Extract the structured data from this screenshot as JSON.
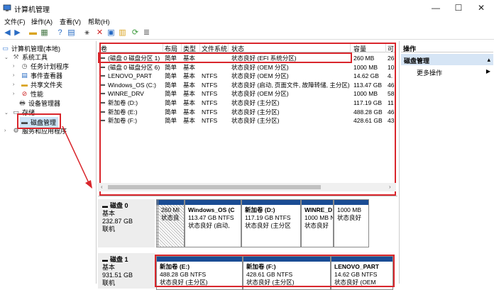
{
  "window": {
    "title": "计算机管理",
    "minimize": "—",
    "maximize": "☐",
    "close": "✕"
  },
  "menu": [
    "文件(F)",
    "操作(A)",
    "查看(V)",
    "帮助(H)"
  ],
  "tree": {
    "root": "计算机管理(本地)",
    "system_tools": "系统工具",
    "task_scheduler": "任务计划程序",
    "event_viewer": "事件查看器",
    "shared_folders": "共享文件夹",
    "performance": "性能",
    "device_manager": "设备管理器",
    "storage": "存储",
    "disk_management": "磁盘管理",
    "services": "服务和应用程序"
  },
  "columns": [
    "卷",
    "布局",
    "类型",
    "文件系统",
    "状态",
    "容量",
    "可"
  ],
  "volumes": [
    {
      "name": "(磁盘 0 磁盘分区 1)",
      "layout": "简单",
      "type": "基本",
      "fs": "",
      "status": "状态良好 (EFI 系统分区)",
      "capacity": "260 MB",
      "free": "26"
    },
    {
      "name": "(磁盘 0 磁盘分区 6)",
      "layout": "简单",
      "type": "基本",
      "fs": "",
      "status": "状态良好 (OEM 分区)",
      "capacity": "1000 MB",
      "free": "10"
    },
    {
      "name": "LENOVO_PART",
      "layout": "简单",
      "type": "基本",
      "fs": "NTFS",
      "status": "状态良好 (OEM 分区)",
      "capacity": "14.62 GB",
      "free": "4."
    },
    {
      "name": "Windows_OS (C:)",
      "layout": "简单",
      "type": "基本",
      "fs": "NTFS",
      "status": "状态良好 (启动, 页面文件, 故障转储, 主分区)",
      "capacity": "113.47 GB",
      "free": "46"
    },
    {
      "name": "WINRE_DRV",
      "layout": "简单",
      "type": "基本",
      "fs": "NTFS",
      "status": "状态良好 (OEM 分区)",
      "capacity": "1000 MB",
      "free": "58"
    },
    {
      "name": "新加卷 (D:)",
      "layout": "简单",
      "type": "基本",
      "fs": "NTFS",
      "status": "状态良好 (主分区)",
      "capacity": "117.19 GB",
      "free": "11"
    },
    {
      "name": "新加卷 (E:)",
      "layout": "简单",
      "type": "基本",
      "fs": "NTFS",
      "status": "状态良好 (主分区)",
      "capacity": "488.28 GB",
      "free": "46"
    },
    {
      "name": "新加卷 (F:)",
      "layout": "简单",
      "type": "基本",
      "fs": "NTFS",
      "status": "状态良好 (主分区)",
      "capacity": "428.61 GB",
      "free": "43"
    }
  ],
  "disk0": {
    "name": "磁盘 0",
    "kind": "基本",
    "size": "232.87 GB",
    "state": "联机",
    "parts": [
      {
        "l1": "",
        "l2": "",
        "l3": ""
      },
      {
        "l1": "",
        "l2": "260 MI",
        "l3": "状态良"
      },
      {
        "l1": "Windows_OS (C",
        "l2": "113.47 GB NTFS",
        "l3": "状态良好 (启动,"
      },
      {
        "l1": "新加卷 (D:)",
        "l2": "117.19 GB NTFS",
        "l3": "状态良好 (主分区"
      },
      {
        "l1": "WINRE_D",
        "l2": "1000 MB N",
        "l3": "状态良好"
      },
      {
        "l1": "",
        "l2": "1000 MB",
        "l3": "状态良好"
      }
    ]
  },
  "disk1": {
    "name": "磁盘 1",
    "kind": "基本",
    "size": "931.51 GB",
    "state": "联机",
    "parts": [
      {
        "l1": "新加卷 (E:)",
        "l2": "488.28 GB NTFS",
        "l3": "状态良好 (主分区)"
      },
      {
        "l1": "新加卷 (F:)",
        "l2": "428.61 GB NTFS",
        "l3": "状态良好 (主分区)"
      },
      {
        "l1": "LENOVO_PART",
        "l2": "14.62 GB NTFS",
        "l3": "状态良好 (OEM"
      }
    ]
  },
  "actions": {
    "header": "操作",
    "section": "磁盘管理",
    "more": "更多操作"
  }
}
